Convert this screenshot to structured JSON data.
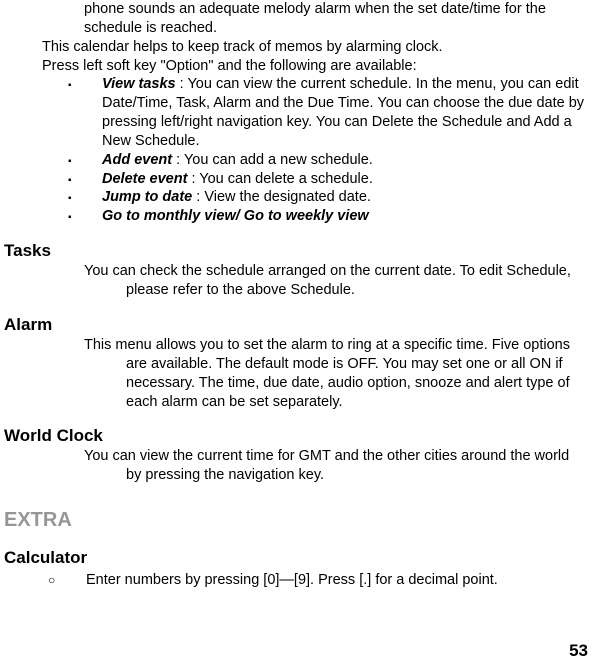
{
  "continuation": "phone sounds an adequate melody alarm when the set date/time for the schedule is reached.",
  "intro_line1": "This calendar helps to keep track of memos by alarming clock.",
  "intro_line2": "Press left soft key \"Option\" and the following are available:",
  "options": [
    {
      "label": "View tasks",
      "desc": " : You can view the current schedule. In the menu, you can edit Date/Time, Task, Alarm and the Due Time. You can choose the due date by pressing left/right navigation key. You can Delete the Schedule and Add a New Schedule."
    },
    {
      "label": "Add event",
      "desc": " : You can add a new schedule."
    },
    {
      "label": "Delete event",
      "desc": " : You can delete a schedule."
    },
    {
      "label": "Jump to date",
      "desc": " : View the designated date."
    },
    {
      "label": "Go to monthly view/ Go to weekly view",
      "desc": ""
    }
  ],
  "sections": {
    "tasks": {
      "heading": "Tasks",
      "body": "You can check the schedule arranged on the current date. To edit Schedule, please refer to the above Schedule."
    },
    "alarm": {
      "heading": "Alarm",
      "body": "This menu allows you to set the alarm to ring at a specific time. Five options are available. The default mode is OFF. You may set one or all ON if necessary. The time, due date, audio option, snooze and alert type of each alarm can be set separately."
    },
    "worldclock": {
      "heading": "World Clock",
      "body": "You can view the current time for GMT and the other cities around the world by pressing the navigation key."
    }
  },
  "extra": {
    "heading": "EXTRA",
    "calculator": {
      "heading": "Calculator",
      "item": "Enter numbers by pressing [0]—[9]. Press [.] for a decimal point."
    }
  },
  "page_number": "53"
}
